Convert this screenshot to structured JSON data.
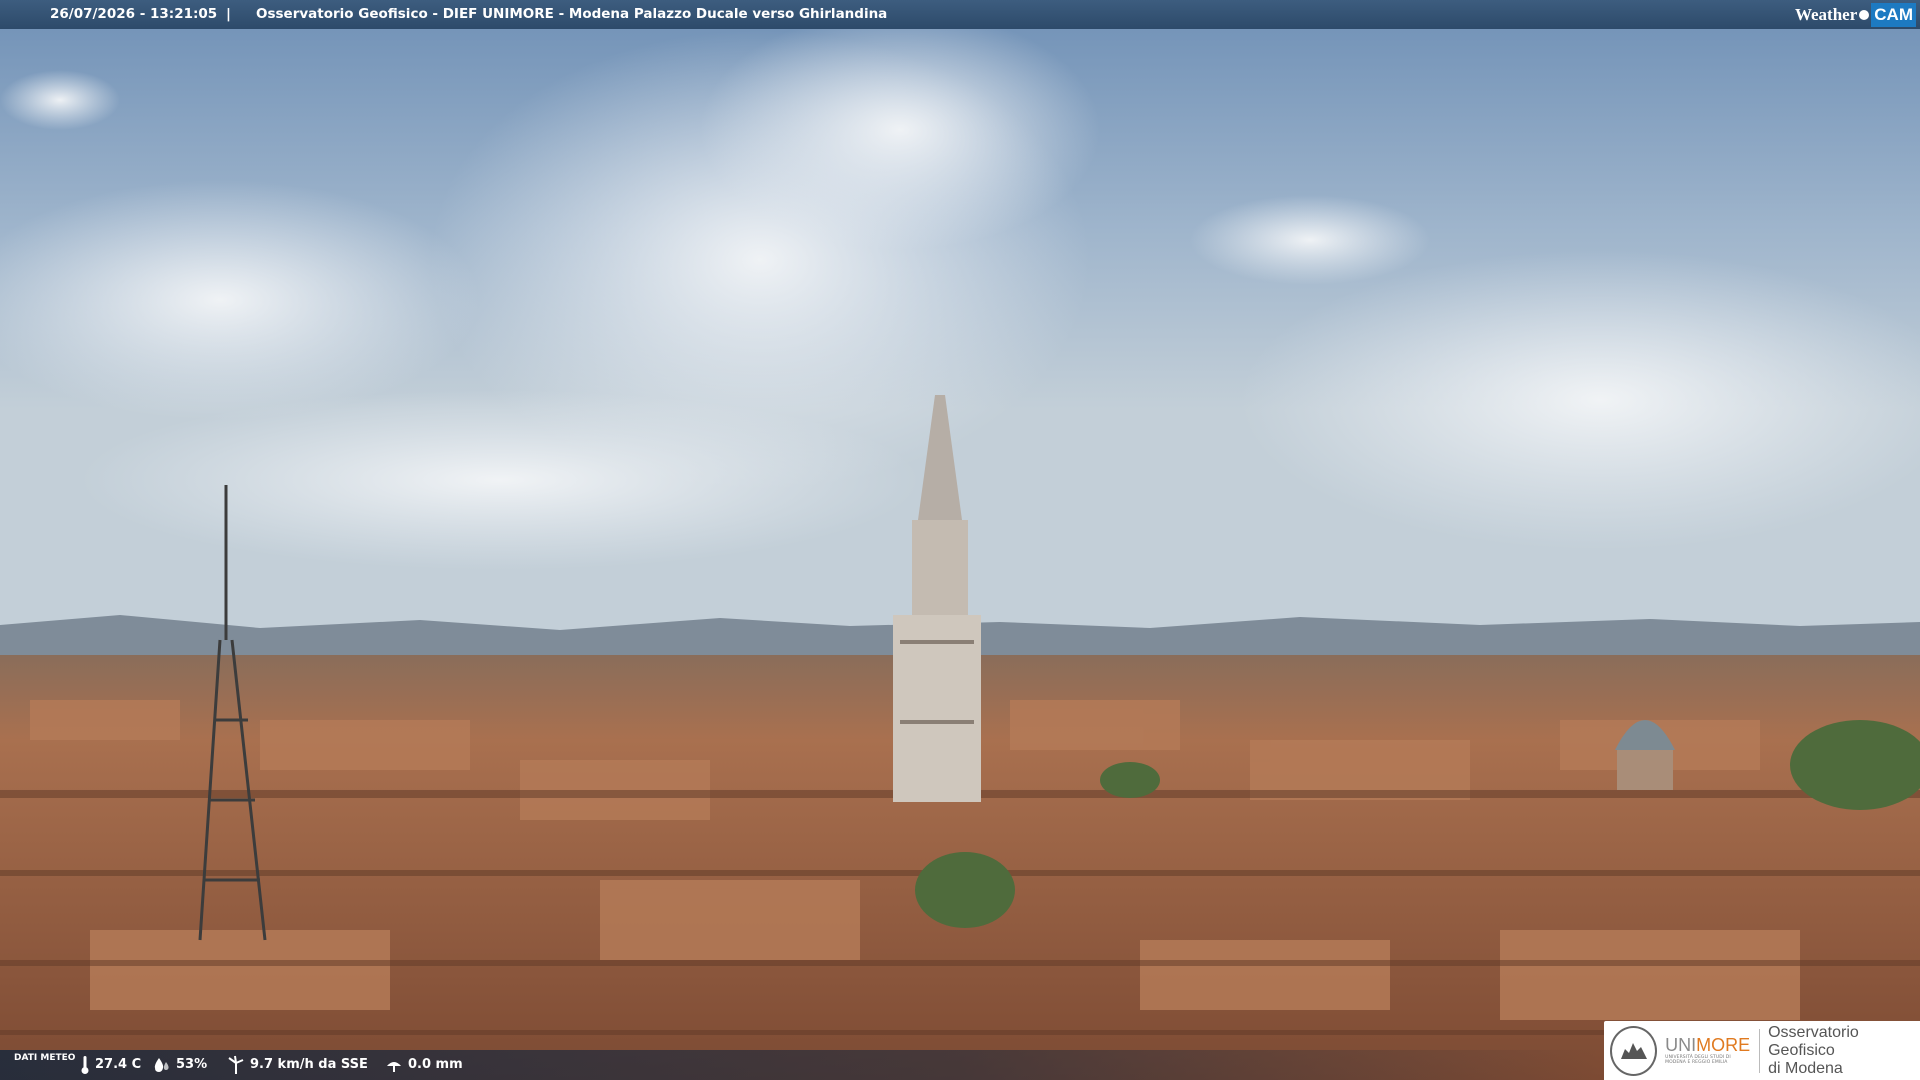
{
  "top_bar": {
    "timestamp": "26/07/2026 - 13:21:05",
    "separator": "|",
    "title": "Osservatorio Geofisico - DIEF UNIMORE - Modena Palazzo Ducale verso Ghirlandina"
  },
  "brand": {
    "weather": "Weather",
    "cam": "CAM",
    "accent_color": "#1d7ac2"
  },
  "bottom_bar": {
    "dati_meteo": "DATI METEO",
    "temperature": "27.4 C",
    "humidity": "53%",
    "wind": "9.7 km/h da SSE",
    "rain": "0.0 mm",
    "icons": [
      "thermometer-icon",
      "humidity-drop-icon",
      "wind-turbine-icon",
      "rain-gauge-icon"
    ]
  },
  "logo": {
    "unimore_prefix": "UNI",
    "unimore_suffix": "MORE",
    "unimore_sub": "UNIVERSITÀ DEGLI STUDI DI MODENA E REGGIO EMILIA",
    "osservatorio_line1": "Osservatorio Geofisico",
    "osservatorio_line2": "di Modena",
    "accent_color": "#e07a20"
  },
  "scene": {
    "description_icon": "webcam-photo"
  }
}
